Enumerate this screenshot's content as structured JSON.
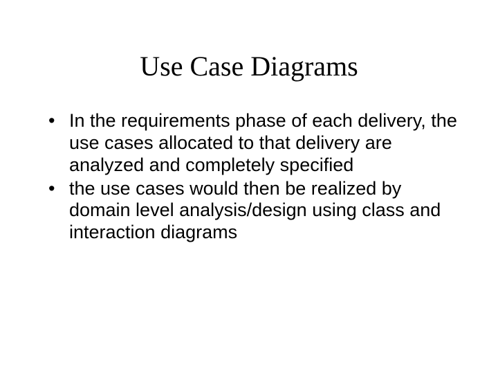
{
  "slide": {
    "title": "Use Case Diagrams",
    "bullets": [
      "In the requirements phase of each delivery, the use cases allocated to that delivery are analyzed and completely specified",
      "the use cases would then be realized by domain level analysis/design using class and interaction diagrams"
    ]
  }
}
